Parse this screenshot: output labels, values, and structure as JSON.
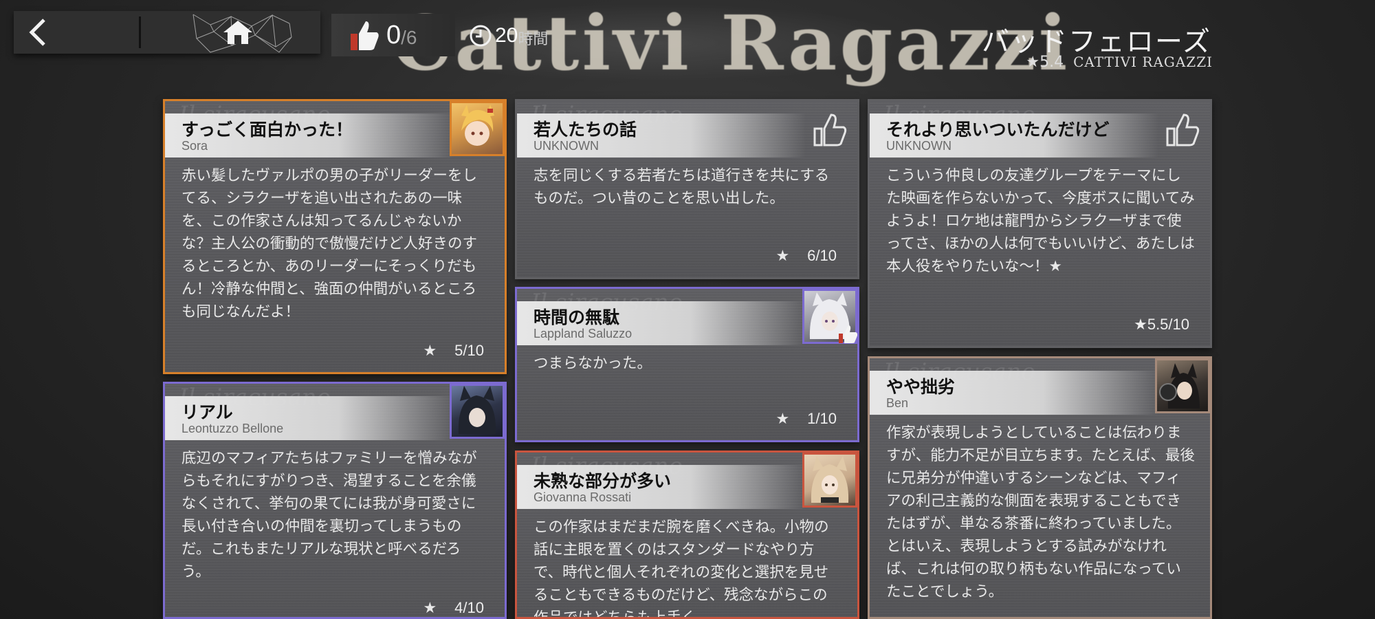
{
  "header": {
    "film_title_bg": "Cattivi Ragazzi",
    "likes_count": "0",
    "likes_total": "/6",
    "time_value": "20",
    "time_unit": "時間",
    "film_title_jp": "バッドフェローズ",
    "film_rating": "★5.4",
    "film_title_en": "CATTIVI RAGAZZI"
  },
  "cards": [
    {
      "title": "すっごく面白かった！",
      "author": "Sora",
      "body": "赤い髪したヴァルポの男の子がリーダーをしてる、シラクーザを追い出されたあの一味を、この作家さんは知ってるんじゃないかな？主人公の衝動的で傲慢だけど人好きのするところとか、あのリーダーにそっくりだもん！冷静な仲間と、強面の仲間がいるところも同じなんだよ！",
      "rating": "5/10",
      "accent": "#d7802a"
    },
    {
      "title": "リアル",
      "author": "Leontuzzo Bellone",
      "body": "底辺のマフィアたちはファミリーを憎みながらもそれにすがりつき、渇望することを余儀なくされて、挙句の果てには我が身可愛さに長い付き合いの仲間を裏切ってしまうものだ。これもまたリアルな現状と呼べるだろう。",
      "rating": "4/10",
      "accent": "#7c6bd0"
    },
    {
      "title": "若人たちの話",
      "author": "UNKNOWN",
      "body": "志を同じくする若者たちは道行きを共にするものだ。つい昔のことを思い出した。",
      "rating": "6/10",
      "accent": "#5f5f62"
    },
    {
      "title": "時間の無駄",
      "author": "Lappland Saluzzo",
      "body": "つまらなかった。",
      "rating": "1/10",
      "accent": "#7c6bd0"
    },
    {
      "title": "未熟な部分が多い",
      "author": "Giovanna Rossati",
      "body": "この作家はまだまだ腕を磨くべきね。小物の話に主眼を置くのはスタンダードなやり方で、時代と個人それぞれの変化と選択を見せることもできるものだけど、残念ながらこの作品ではどちらも上手く",
      "rating": "",
      "accent": "#c9553f"
    },
    {
      "title": "それより思いついたんだけど",
      "author": "UNKNOWN",
      "body": "こういう仲良しの友達グループをテーマにした映画を作らないかって、今度ボスに聞いてみようよ！ロケ地は龍門からシラクーザまで使ってさ、ほかの人は何でもいいけど、あたしは本人役をやりたいな〜！★",
      "rating": "★5.5/10",
      "accent": "#5f5f62"
    },
    {
      "title": "やや拙劣",
      "author": "Ben",
      "body": "作家が表現しようとしていることは伝わりますが、能力不足が目立ちます。たとえば、最後に兄弟分が仲違いするシーンなどは、マフィアの利己主義的な側面を表現することもできたはずが、単なる茶番に終わっていました。とはいえ、表現しようとする試みがなければ、これは何の取り柄もない作品になっていたことでしょう。",
      "rating": "",
      "accent": "#a58a7a"
    }
  ],
  "watermark": "Il siracusano"
}
